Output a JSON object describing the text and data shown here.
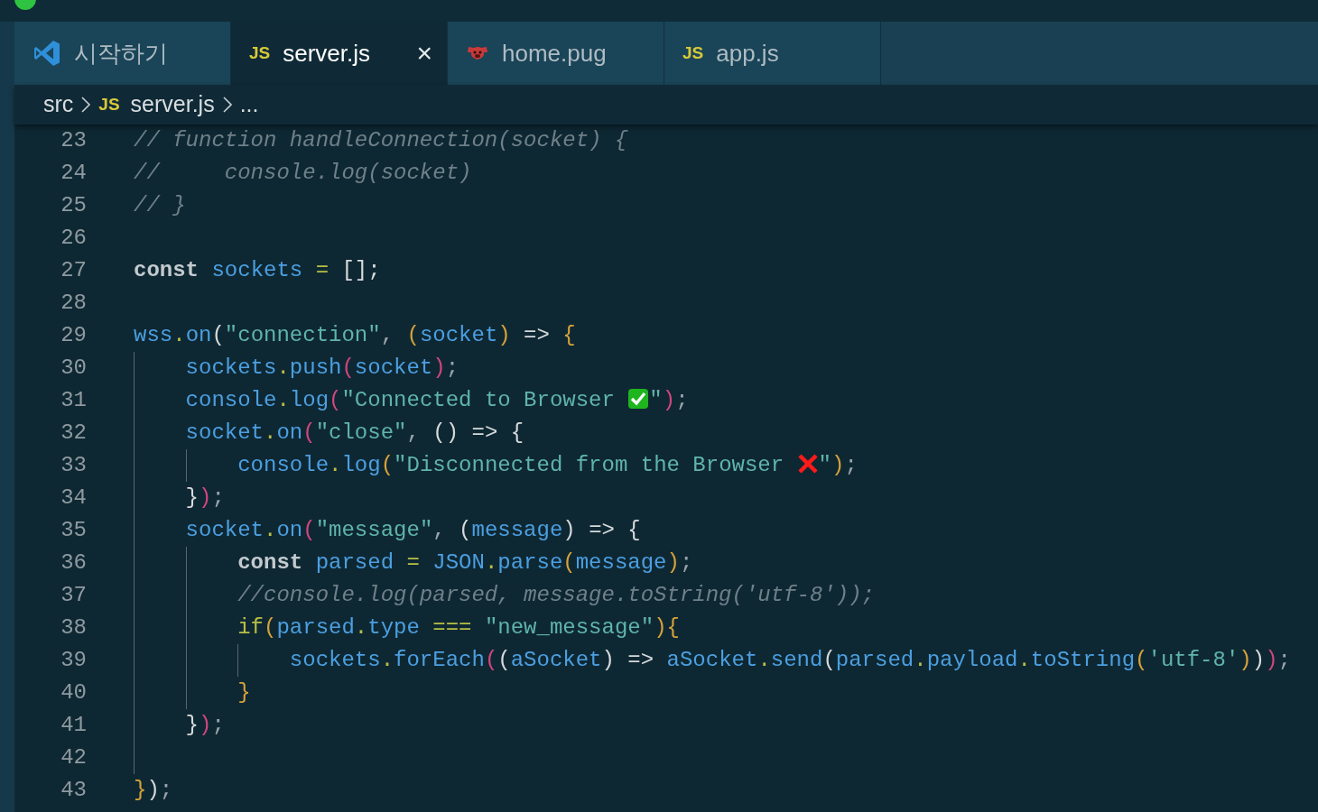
{
  "tabs": [
    {
      "kind": "welcome",
      "label": "시작하기",
      "selected": false
    },
    {
      "kind": "script",
      "badge": "JS",
      "label": "server.js",
      "selected": true,
      "close": "×"
    },
    {
      "kind": "template",
      "label": "home.pug",
      "selected": false
    },
    {
      "kind": "script",
      "badge": "JS",
      "label": "app.js",
      "selected": false
    }
  ],
  "breadcrumb": [
    {
      "label": "src"
    },
    {
      "badge": "JS",
      "label": "server.js"
    },
    {
      "label": "..."
    }
  ],
  "lines": [
    {
      "number": "23",
      "tokens": [
        {
          "kind": "comment",
          "text": "// function handleConnection(socket) {"
        }
      ]
    },
    {
      "number": "24",
      "tokens": [
        {
          "kind": "comment",
          "text": "//     console.log(socket)"
        }
      ]
    },
    {
      "number": "25",
      "tokens": [
        {
          "kind": "comment",
          "text": "// }"
        }
      ]
    },
    {
      "number": "26"
    },
    {
      "number": "27",
      "tokens": [
        {
          "kind": "keyword",
          "text": "const"
        },
        {
          "kind": "ident",
          "text": " sockets "
        },
        {
          "kind": "op",
          "text": "="
        },
        {
          "kind": "plain",
          "text": " [];"
        }
      ]
    },
    {
      "number": "28"
    },
    {
      "number": "29",
      "tokens": [
        {
          "kind": "ident",
          "text": "wss"
        },
        {
          "kind": "op",
          "text": "."
        },
        {
          "kind": "ident",
          "text": "on"
        },
        {
          "kind": "plain",
          "text": "("
        },
        {
          "kind": "string",
          "text": "\"connection\""
        },
        {
          "kind": "punct",
          "text": ", "
        },
        {
          "kind": "bracket1",
          "text": "("
        },
        {
          "kind": "ident",
          "text": "socket"
        },
        {
          "kind": "bracket1",
          "text": ")"
        },
        {
          "kind": "plain",
          "text": " => "
        },
        {
          "kind": "bracket1",
          "text": "{"
        }
      ]
    },
    {
      "number": "30",
      "tokens": [
        {
          "kind": "ident",
          "text": "    sockets"
        },
        {
          "kind": "op",
          "text": "."
        },
        {
          "kind": "ident",
          "text": "push"
        },
        {
          "kind": "bracket2",
          "text": "("
        },
        {
          "kind": "ident",
          "text": "socket"
        },
        {
          "kind": "bracket2",
          "text": ")"
        },
        {
          "kind": "punct",
          "text": ";"
        }
      ]
    },
    {
      "number": "31",
      "tokens": [
        {
          "kind": "ident",
          "text": "    console"
        },
        {
          "kind": "op",
          "text": "."
        },
        {
          "kind": "ident",
          "text": "log"
        },
        {
          "kind": "bracket2",
          "text": "("
        },
        {
          "kind": "string",
          "text": "\"Connected to Browser "
        },
        {
          "kind": "check-mark"
        },
        {
          "kind": "string",
          "text": "\""
        },
        {
          "kind": "bracket2",
          "text": ")"
        },
        {
          "kind": "punct",
          "text": ";"
        }
      ]
    },
    {
      "number": "32",
      "tokens": [
        {
          "kind": "ident",
          "text": "    socket"
        },
        {
          "kind": "op",
          "text": "."
        },
        {
          "kind": "ident",
          "text": "on"
        },
        {
          "kind": "bracket2",
          "text": "("
        },
        {
          "kind": "string",
          "text": "\"close\""
        },
        {
          "kind": "punct",
          "text": ", "
        },
        {
          "kind": "plain",
          "text": "() => {"
        }
      ]
    },
    {
      "number": "33",
      "tokens": [
        {
          "kind": "ident",
          "text": "        console"
        },
        {
          "kind": "op",
          "text": "."
        },
        {
          "kind": "ident",
          "text": "log"
        },
        {
          "kind": "bracket1",
          "text": "("
        },
        {
          "kind": "string",
          "text": "\"Disconnected from the Browser "
        },
        {
          "kind": "cross-mark"
        },
        {
          "kind": "string",
          "text": "\""
        },
        {
          "kind": "bracket1",
          "text": ")"
        },
        {
          "kind": "punct",
          "text": ";"
        }
      ]
    },
    {
      "number": "34",
      "tokens": [
        {
          "kind": "plain",
          "text": "    }"
        },
        {
          "kind": "bracket2",
          "text": ")"
        },
        {
          "kind": "punct",
          "text": ";"
        }
      ]
    },
    {
      "number": "35",
      "tokens": [
        {
          "kind": "ident",
          "text": "    socket"
        },
        {
          "kind": "op",
          "text": "."
        },
        {
          "kind": "ident",
          "text": "on"
        },
        {
          "kind": "bracket2",
          "text": "("
        },
        {
          "kind": "string",
          "text": "\"message\""
        },
        {
          "kind": "punct",
          "text": ", "
        },
        {
          "kind": "plain",
          "text": "("
        },
        {
          "kind": "ident",
          "text": "message"
        },
        {
          "kind": "plain",
          "text": ") => {"
        }
      ]
    },
    {
      "number": "36",
      "tokens": [
        {
          "kind": "keyword",
          "text": "        const"
        },
        {
          "kind": "ident",
          "text": " parsed "
        },
        {
          "kind": "op",
          "text": "="
        },
        {
          "kind": "ident",
          "text": " JSON"
        },
        {
          "kind": "op",
          "text": "."
        },
        {
          "kind": "ident",
          "text": "parse"
        },
        {
          "kind": "bracket1",
          "text": "("
        },
        {
          "kind": "ident",
          "text": "message"
        },
        {
          "kind": "bracket1",
          "text": ")"
        },
        {
          "kind": "punct",
          "text": ";"
        }
      ]
    },
    {
      "number": "37",
      "tokens": [
        {
          "kind": "comment",
          "text": "        //console.log(parsed, message.toString('utf-8'));"
        }
      ]
    },
    {
      "number": "38",
      "tokens": [
        {
          "kind": "control",
          "text": "        if"
        },
        {
          "kind": "bracket1",
          "text": "("
        },
        {
          "kind": "ident",
          "text": "parsed"
        },
        {
          "kind": "op",
          "text": "."
        },
        {
          "kind": "ident",
          "text": "type "
        },
        {
          "kind": "op",
          "text": "==="
        },
        {
          "kind": "string",
          "text": " \"new_message\""
        },
        {
          "kind": "bracket1",
          "text": "){"
        }
      ]
    },
    {
      "number": "39",
      "tokens": [
        {
          "kind": "ident",
          "text": "            sockets"
        },
        {
          "kind": "op",
          "text": "."
        },
        {
          "kind": "ident",
          "text": "forEach"
        },
        {
          "kind": "bracket2",
          "text": "("
        },
        {
          "kind": "plain",
          "text": "("
        },
        {
          "kind": "ident",
          "text": "aSocket"
        },
        {
          "kind": "plain",
          "text": ") => "
        },
        {
          "kind": "ident",
          "text": "aSocket"
        },
        {
          "kind": "op",
          "text": "."
        },
        {
          "kind": "ident",
          "text": "send"
        },
        {
          "kind": "plain",
          "text": "("
        },
        {
          "kind": "ident",
          "text": "parsed"
        },
        {
          "kind": "op",
          "text": "."
        },
        {
          "kind": "ident",
          "text": "payload"
        },
        {
          "kind": "op",
          "text": "."
        },
        {
          "kind": "ident",
          "text": "toString"
        },
        {
          "kind": "bracket1",
          "text": "("
        },
        {
          "kind": "string",
          "text": "'utf-8'"
        },
        {
          "kind": "bracket1",
          "text": ")"
        },
        {
          "kind": "plain",
          "text": ")"
        },
        {
          "kind": "bracket2",
          "text": ")"
        },
        {
          "kind": "punct",
          "text": ";"
        }
      ]
    },
    {
      "number": "40",
      "tokens": [
        {
          "kind": "bracket1",
          "text": "        }"
        }
      ]
    },
    {
      "number": "41",
      "tokens": [
        {
          "kind": "plain",
          "text": "    }"
        },
        {
          "kind": "bracket2",
          "text": ")"
        },
        {
          "kind": "punct",
          "text": ";"
        }
      ]
    },
    {
      "number": "42"
    },
    {
      "number": "43",
      "tokens": [
        {
          "kind": "bracket1",
          "text": "}"
        },
        {
          "kind": "plain",
          "text": ")"
        },
        {
          "kind": "punct",
          "text": ";"
        }
      ]
    }
  ]
}
